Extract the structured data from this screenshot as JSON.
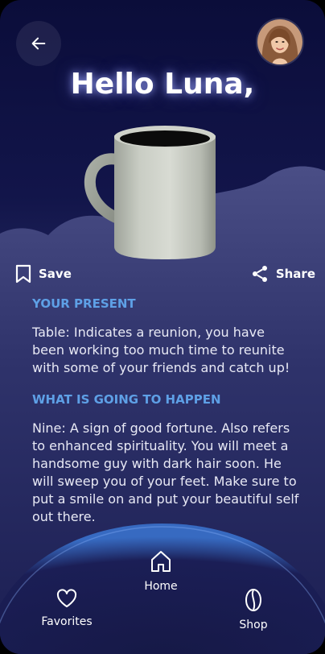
{
  "header": {
    "greeting": "Hello Luna,"
  },
  "actions": {
    "save_label": "Save",
    "share_label": "Share"
  },
  "sections": [
    {
      "title": "YOUR PRESENT",
      "body": "Table: Indicates a reunion, you have been working too much time to reunite with some of your friends and catch up!"
    },
    {
      "title": "WHAT IS GOING TO HAPPEN",
      "body": "Nine: A sign of good fortune. Also refers to enhanced spirituality. You will meet a handsome guy with dark hair soon. He will sweep you of your feet. Make sure to put a smile on and put your beautiful self out there."
    }
  ],
  "nav": {
    "favorites_label": "Favorites",
    "home_label": "Home",
    "shop_label": "Shop"
  },
  "colors": {
    "accent": "#5ea0e6",
    "background": "#12154a"
  },
  "icons": [
    "arrow-left-icon",
    "bookmark-icon",
    "share-icon",
    "heart-icon",
    "home-icon",
    "coffee-bean-icon"
  ]
}
